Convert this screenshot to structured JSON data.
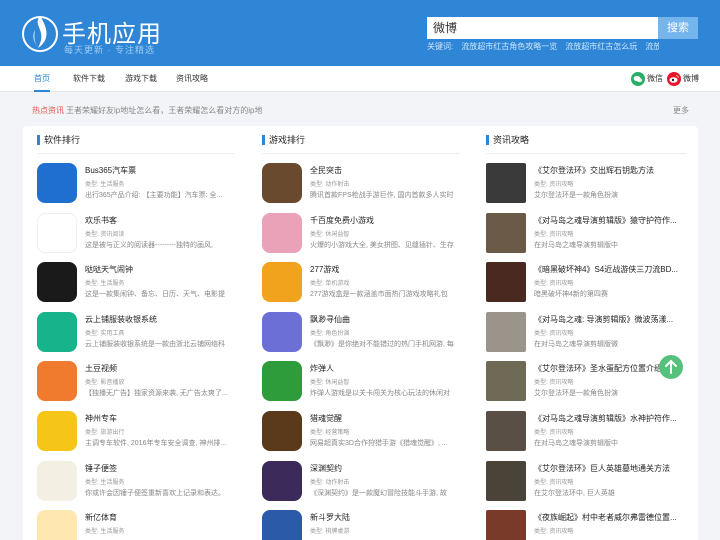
{
  "brand": {
    "title": "手机应用",
    "subtitle": "每天更新 · 专注精选",
    "logo_icon": "flame-icon"
  },
  "search": {
    "value": "微博",
    "button_label": "搜索",
    "keywords_label": "关键词:",
    "keywords": [
      "流放超市红古角色攻略一览",
      "流放超市红古怎么玩",
      "流放超市..."
    ]
  },
  "nav": {
    "items": [
      "首页",
      "软件下载",
      "游戏下载",
      "资讯攻略"
    ],
    "active_index": 0,
    "share": [
      {
        "label": "微信",
        "icon": "wechat-icon",
        "color": "#2aae67"
      },
      {
        "label": "微博",
        "icon": "weibo-icon",
        "color": "#e6162d"
      }
    ]
  },
  "hot": {
    "label": "热点资讯",
    "text": "王者荣耀好友ip地址怎么看，王者荣耀怎么看对方的ip地",
    "more_label": "更多"
  },
  "columns": [
    {
      "title": "软件排行",
      "items": [
        {
          "title": "Bus365汽车票",
          "type": "类型: 生活服务",
          "desc": "出行365产品介绍: 【主要功能】汽车票: 全...",
          "icon": "bus-app-icon",
          "color": "#1f6fd1"
        },
        {
          "title": "欢乐书客",
          "type": "类型: 资讯阅读",
          "desc": "这是被与正义的阅读器---------独特的画风,",
          "icon": "glasses-app-icon",
          "color": "#ffffff"
        },
        {
          "title": "哒哒天气闹钟",
          "type": "类型: 生活服务",
          "desc": "这是一款集闹钟、备忘、日历、天气、电影提",
          "icon": "weather-clock-app-icon",
          "color": "#1a1a1a"
        },
        {
          "title": "云上铺服装收银系统",
          "type": "类型: 实用工具",
          "desc": "云上铺服装收银系统是一款由浙北云铺网络科",
          "icon": "cloud-shop-app-icon",
          "color": "#17b38a"
        },
        {
          "title": "土豆视频",
          "type": "类型: 影音播放",
          "desc": "【独播无广告】独家资源来袭, 无广告太爽了...",
          "icon": "tudou-app-icon",
          "color": "#f07a2e"
        },
        {
          "title": "神州专车",
          "type": "类型: 旅游出行",
          "desc": "主调专车软件, 2016年专车安全调查, 神州排...",
          "icon": "car-app-icon",
          "color": "#f5c518"
        },
        {
          "title": "锤子便签",
          "type": "类型: 生活服务",
          "desc": "你或许会因锤子便签重新喜欢上记录和表达。",
          "icon": "notes-app-icon",
          "color": "#f4efe3"
        },
        {
          "title": "新亿体育",
          "type": "类型: 生活服务",
          "desc": "",
          "icon": "sports-app-icon",
          "color": "#ffe8b0"
        }
      ]
    },
    {
      "title": "游戏排行",
      "items": [
        {
          "title": "全民突击",
          "type": "类型: 动作射击",
          "desc": "腾讯首款FPS枪战手游巨作, 国内首款多人实时",
          "icon": "soldier-game-icon",
          "color": "#6a4a2e"
        },
        {
          "title": "千百度免费小游戏",
          "type": "类型: 休闲益智",
          "desc": "火爆的小游戏大全, 美女拼图、见缝插针、生存",
          "icon": "gamepad-game-icon",
          "color": "#e9a2b8"
        },
        {
          "title": "277游戏",
          "type": "类型: 单机游戏",
          "desc": "277游戏盒是一款涵盖市面热门游戏攻略礼包",
          "icon": "277-game-icon",
          "color": "#f1a31d"
        },
        {
          "title": "飘渺寻仙曲",
          "type": "类型: 角色扮演",
          "desc": "《飘渺》是你绝对不能错过的热门手机网游, 每",
          "icon": "fairy-game-icon",
          "color": "#6c6fd6"
        },
        {
          "title": "炸弹人",
          "type": "类型: 休闲益智",
          "desc": "炸弹人游戏是以关卡闯关为核心玩法的休闲对",
          "icon": "bomberman-game-icon",
          "color": "#2e9c3b"
        },
        {
          "title": "猎魂觉醒",
          "type": "类型: 经营策略",
          "desc": "网易超真实3D合作狩猎手游《猎魂觉醒》, ...",
          "icon": "dragon-game-icon",
          "color": "#5a3a1a"
        },
        {
          "title": "深渊契约",
          "type": "类型: 动作射击",
          "desc": "《深渊契约》是一款魔幻冒险技能斗手游, 故",
          "icon": "warrior-game-icon",
          "color": "#3b2a5a"
        },
        {
          "title": "新斗罗大陆",
          "type": "类型: 棋牌桌游",
          "desc": "",
          "icon": "douluo-game-icon",
          "color": "#2a5aa8"
        }
      ]
    },
    {
      "title": "资讯攻略",
      "items": [
        {
          "title": "《艾尔登法环》交出辉石钥匙方法",
          "type": "类型: 资讯攻略",
          "desc": "艾尔登法环是一款角色扮演",
          "icon": "article-thumb-icon",
          "color": "#3a3a3a"
        },
        {
          "title": "《对马岛之魂导演剪辑版》猿守护符作...",
          "type": "类型: 资讯攻略",
          "desc": "在对马岛之魂导演剪辑版中",
          "icon": "article-thumb-icon",
          "color": "#6b5a48"
        },
        {
          "title": "《暗黑破坏神4》S4近战游侠三刀流BD...",
          "type": "类型: 资讯攻略",
          "desc": "暗黑破坏神4新的第四赛",
          "icon": "article-thumb-icon",
          "color": "#4a2a20"
        },
        {
          "title": "《对马岛之魂: 导演剪辑版》微波荡漾...",
          "type": "类型: 资讯攻略",
          "desc": "在对马岛之魂导演剪辑版微",
          "icon": "article-thumb-icon",
          "color": "#9a948a"
        },
        {
          "title": "《艾尔登法环》圣水蛋配方位置介绍",
          "type": "类型: 资讯攻略",
          "desc": "艾尔登法环是一款角色扮演",
          "icon": "article-thumb-icon",
          "color": "#6f6a55"
        },
        {
          "title": "《对马岛之魂导演剪辑版》水神护符作...",
          "type": "类型: 资讯攻略",
          "desc": "在对马岛之魂导演剪辑版中",
          "icon": "article-thumb-icon",
          "color": "#5a4f44"
        },
        {
          "title": "《艾尔登法环》巨人英雄墓地通关方法",
          "type": "类型: 资讯攻略",
          "desc": "在艾尔登法环中, 巨人英雄",
          "icon": "article-thumb-icon",
          "color": "#4a4438"
        },
        {
          "title": "《夜族崛起》村中老者威尔弗雷德位置...",
          "type": "类型: 资讯攻略",
          "desc": "",
          "icon": "article-thumb-icon",
          "color": "#7a3a2a"
        }
      ]
    }
  ],
  "to_top_icon": "arrow-up-icon"
}
